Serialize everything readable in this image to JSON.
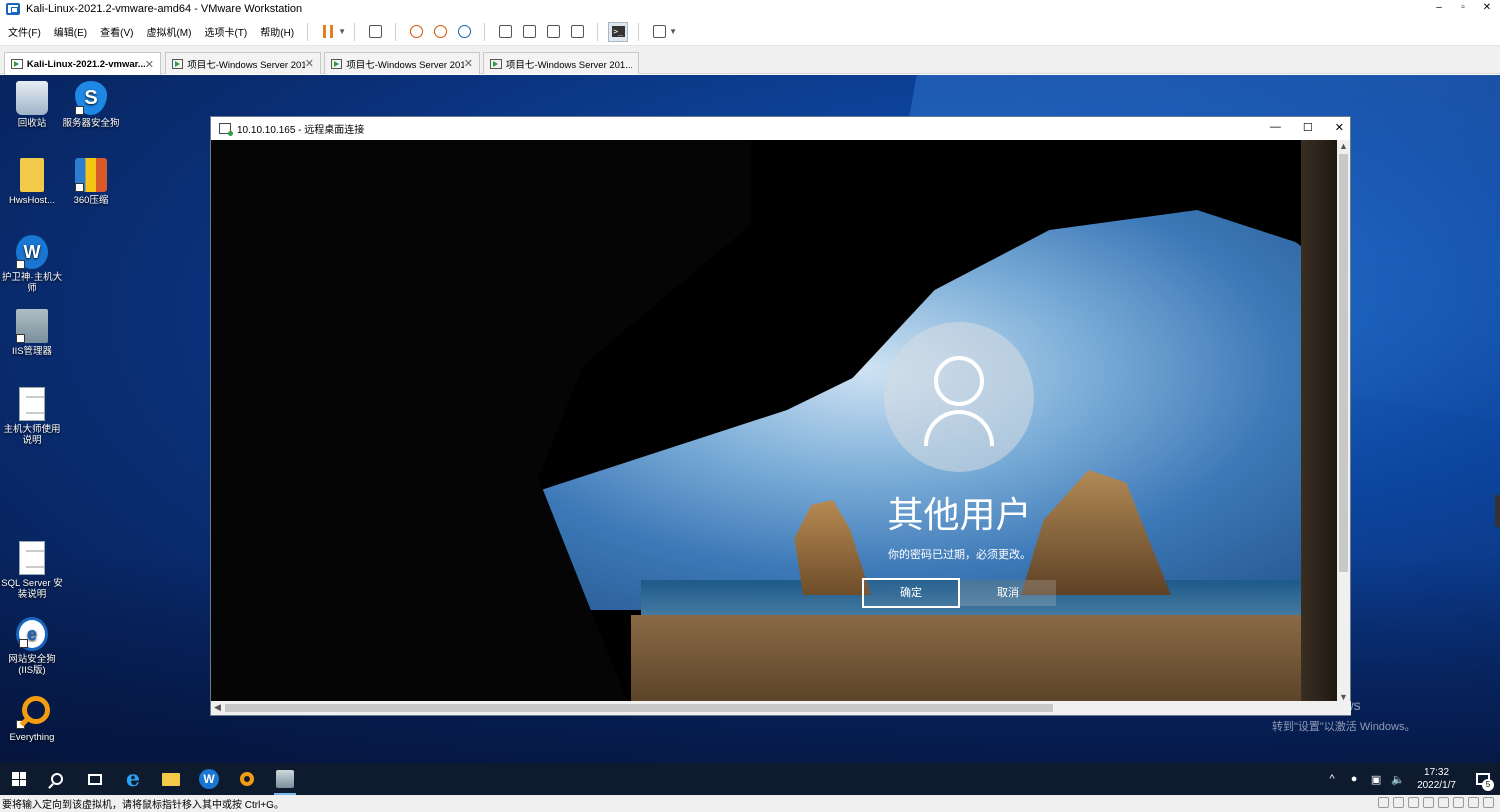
{
  "vmware": {
    "title": "Kali-Linux-2021.2-vmware-amd64 - VMware Workstation",
    "menu": [
      "文件(F)",
      "编辑(E)",
      "查看(V)",
      "虚拟机(M)",
      "选项卡(T)",
      "帮助(H)"
    ],
    "tabs": [
      {
        "label": "Kali-Linux-2021.2-vmwar...",
        "active": true
      },
      {
        "label": "项目七-Windows Server 201...",
        "active": false
      },
      {
        "label": "项目七-Windows Server 201...",
        "active": false
      },
      {
        "label": "项目七-Windows Server 201...",
        "active": false
      }
    ],
    "status_text": "要将输入定向到该虚拟机，请将鼠标指针移入其中或按 Ctrl+G。"
  },
  "desktop": {
    "icons": [
      {
        "label": "回收站",
        "icon": "recycle-bin-icon"
      },
      {
        "label": "服务器安全狗",
        "icon": "safedog-icon"
      },
      {
        "label": "HwsHost...",
        "icon": "folder-icon"
      },
      {
        "label": "360压缩",
        "icon": "360zip-icon"
      },
      {
        "label": "护卫神·主机大师",
        "icon": "huweishen-icon"
      },
      {
        "label": "IIS管理器",
        "icon": "iis-manager-icon"
      },
      {
        "label": "主机大师使用说明",
        "icon": "text-document-icon"
      },
      {
        "label": "SQL Server 安装说明",
        "icon": "text-document-icon"
      },
      {
        "label": "网站安全狗(IIS版)",
        "icon": "website-safedog-icon"
      },
      {
        "label": "Everything",
        "icon": "everything-search-icon"
      }
    ],
    "activate_line1": "激活 Windows",
    "activate_line2": "转到\"设置\"以激活 Windows。"
  },
  "rdp": {
    "title": "10.10.10.165 - 远程桌面连接",
    "lock_user": "其他用户",
    "lock_message": "你的密码已过期，必须更改。",
    "ok_label": "确定",
    "cancel_label": "取消"
  },
  "taskbar": {
    "time": "17:32",
    "date": "2022/1/7",
    "notification_count": "5"
  }
}
